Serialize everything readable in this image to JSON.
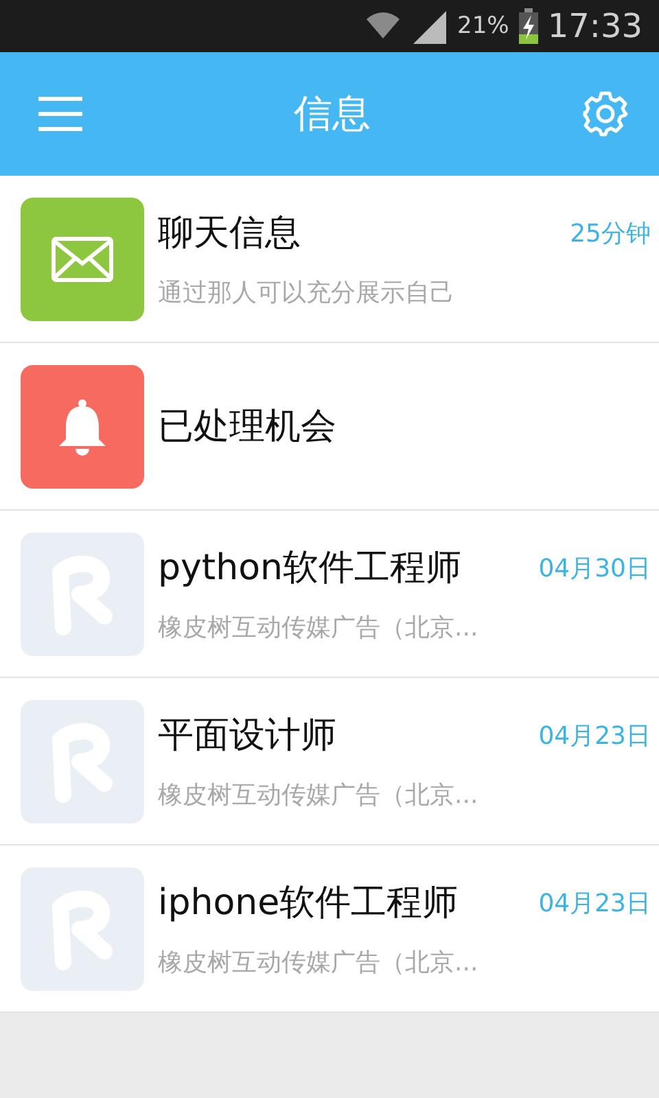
{
  "status_bar": {
    "battery": "21%",
    "time": "17:33"
  },
  "header": {
    "title": "信息"
  },
  "items": [
    {
      "kind": "mail",
      "title": "聊天信息",
      "time": "25分钟",
      "subtitle": "通过那人可以充分展示自己"
    },
    {
      "kind": "bell",
      "title": "已处理机会"
    },
    {
      "kind": "logo",
      "title": "python软件工程师",
      "time": "04月30日",
      "subtitle": "橡皮树互动传媒广告（北京..."
    },
    {
      "kind": "logo",
      "title": "平面设计师",
      "time": "04月23日",
      "subtitle": "橡皮树互动传媒广告（北京..."
    },
    {
      "kind": "logo",
      "title": "iphone软件工程师",
      "time": "04月23日",
      "subtitle": "橡皮树互动传媒广告（北京..."
    }
  ]
}
